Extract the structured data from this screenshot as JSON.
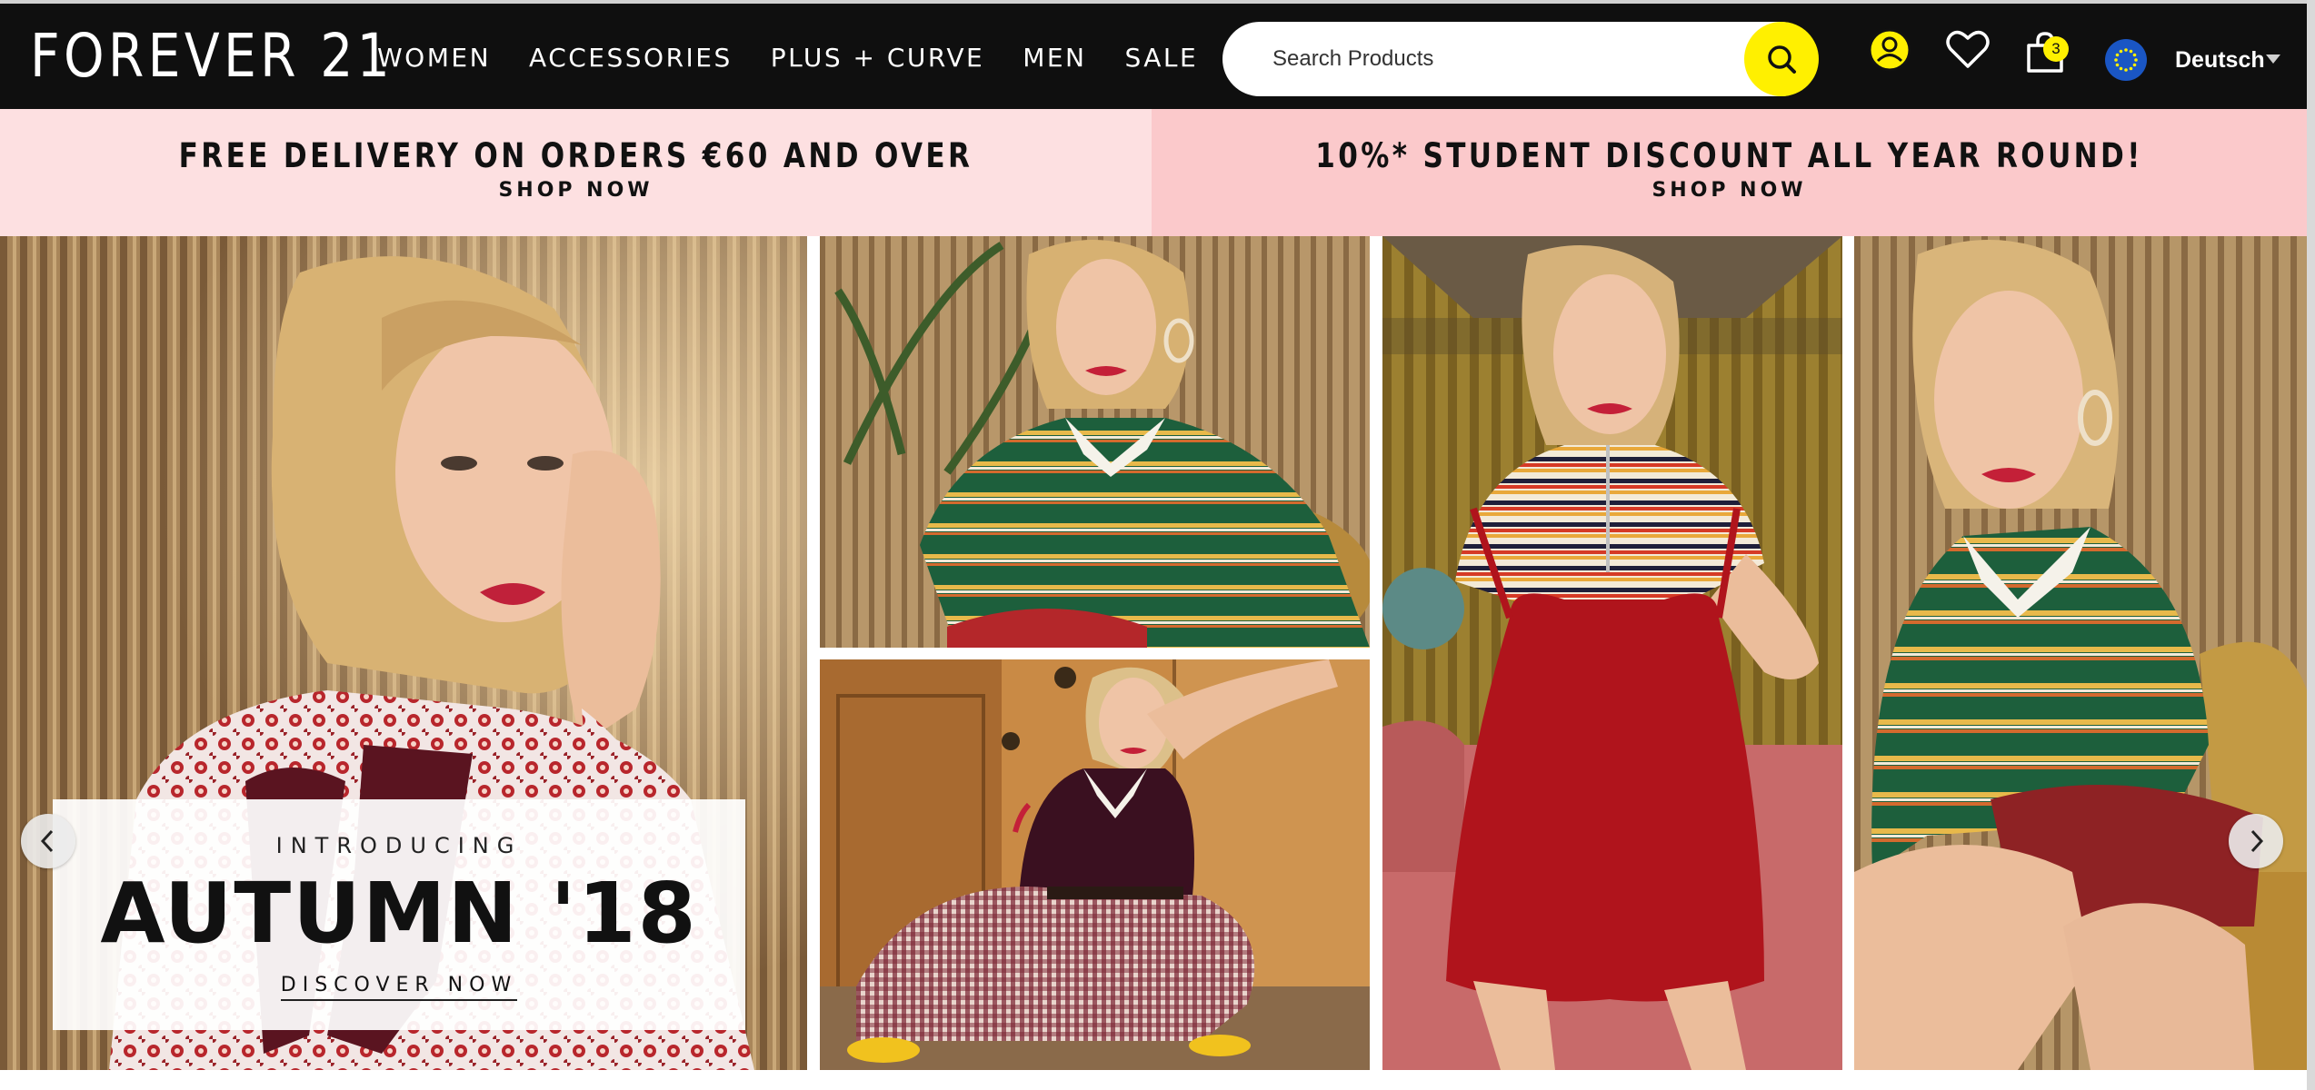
{
  "brand": {
    "logo_text": "FOREVER 21"
  },
  "nav": {
    "items": [
      "WOMEN",
      "ACCESSORIES",
      "PLUS + CURVE",
      "MEN",
      "SALE"
    ]
  },
  "search": {
    "placeholder": "Search Products"
  },
  "header_icons": {
    "account": "account-icon",
    "wishlist": "heart-icon",
    "bag": "shopping-bag-icon",
    "region": "eu-flag-icon",
    "bag_count": "3"
  },
  "language": {
    "selected": "Deutsch"
  },
  "promos": [
    {
      "title": "FREE DELIVERY ON ORDERS €60 AND OVER",
      "link": "SHOP NOW"
    },
    {
      "title": "10%* STUDENT DISCOUNT ALL YEAR ROUND!",
      "link": "SHOP NOW"
    }
  ],
  "hero": {
    "kicker": "INTRODUCING",
    "title": "AUTUMN '18",
    "cta": "DISCOVER NOW",
    "prev_icon": "chevron-left-icon",
    "next_icon": "chevron-right-icon"
  },
  "colors": {
    "header_bg": "#0f0f0f",
    "accent_yellow": "#fff000",
    "promo_left_bg": "#fde0e1",
    "promo_right_bg": "#fbc9cb",
    "eu_blue": "#1a56c4"
  }
}
